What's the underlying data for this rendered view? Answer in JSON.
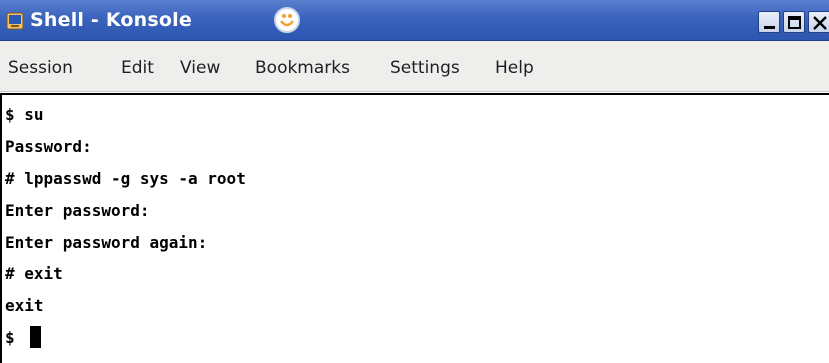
{
  "window": {
    "title": "Shell - Konsole",
    "icons": {
      "app": "konsole-shell-icon",
      "emblem": "konsole-emblem-icon",
      "minimize": "minimize-icon",
      "maximize": "maximize-icon",
      "close": "close-icon"
    },
    "colors": {
      "titlebar": "#3a63bd",
      "title_text": "#ffffff"
    }
  },
  "menubar": {
    "items": [
      {
        "label": "Session"
      },
      {
        "label": "Edit"
      },
      {
        "label": "View"
      },
      {
        "label": "Bookmarks"
      },
      {
        "label": "Settings"
      },
      {
        "label": "Help"
      }
    ]
  },
  "terminal": {
    "lines": [
      "$ su",
      "Password:",
      "# lppasswd -g sys -a root",
      "Enter password:",
      "Enter password again:",
      "# exit",
      "exit",
      "$"
    ],
    "colors": {
      "background": "#ffffff",
      "foreground": "#000000"
    }
  }
}
